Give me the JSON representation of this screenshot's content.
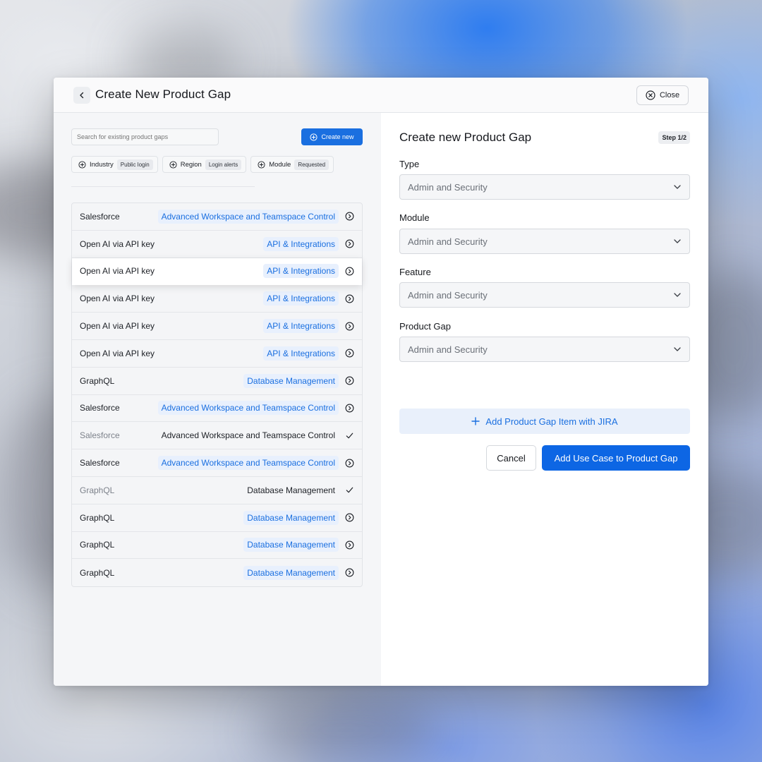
{
  "header": {
    "title": "Create New Product Gap",
    "close_label": "Close"
  },
  "left": {
    "search": {
      "placeholder": "Search for existing product gaps",
      "value": ""
    },
    "create_new_label": "Create new",
    "filters": [
      {
        "label": "Industry",
        "tag": "Public login"
      },
      {
        "label": "Region",
        "tag": "Login alerts"
      },
      {
        "label": "Module",
        "tag": "Requested"
      }
    ],
    "rows": [
      {
        "name": "Salesforce",
        "category": "Advanced Workspace and Teamspace Control",
        "state": "add"
      },
      {
        "name": "Open AI via API key",
        "category": "API & Integrations",
        "state": "add"
      },
      {
        "name": "Open AI via API key",
        "category": "API & Integrations",
        "state": "add",
        "highlight": true
      },
      {
        "name": "Open AI via API key",
        "category": "API & Integrations",
        "state": "add"
      },
      {
        "name": "Open AI via API key",
        "category": "API & Integrations",
        "state": "add"
      },
      {
        "name": "Open AI via API key",
        "category": "API & Integrations",
        "state": "add"
      },
      {
        "name": "GraphQL",
        "category": "Database Management",
        "state": "add"
      },
      {
        "name": "Salesforce",
        "category": "Advanced Workspace and Teamspace Control",
        "state": "add"
      },
      {
        "name": "Salesforce",
        "category": "Advanced Workspace and Teamspace Control",
        "state": "selected"
      },
      {
        "name": "Salesforce",
        "category": "Advanced Workspace and Teamspace Control",
        "state": "add"
      },
      {
        "name": "GraphQL",
        "category": "Database Management",
        "state": "selected"
      },
      {
        "name": "GraphQL",
        "category": "Database Management",
        "state": "add"
      },
      {
        "name": "GraphQL",
        "category": "Database Management",
        "state": "add"
      },
      {
        "name": "GraphQL",
        "category": "Database Management",
        "state": "add"
      }
    ]
  },
  "form": {
    "title": "Create new Product Gap",
    "step": "Step 1/2",
    "fields": [
      {
        "label": "Type",
        "value": "Admin and Security"
      },
      {
        "label": "Module",
        "value": "Admin and Security"
      },
      {
        "label": "Feature",
        "value": "Admin and Security"
      },
      {
        "label": "Product Gap",
        "value": "Admin and Security"
      }
    ],
    "jira_label": "Add Product Gap Item with JIRA",
    "cancel_label": "Cancel",
    "submit_label": "Add Use Case to Product Gap"
  },
  "colors": {
    "accent": "#0d66e4",
    "badge_bg": "#e8f0fd",
    "jira_bg": "#e9f0fb"
  }
}
